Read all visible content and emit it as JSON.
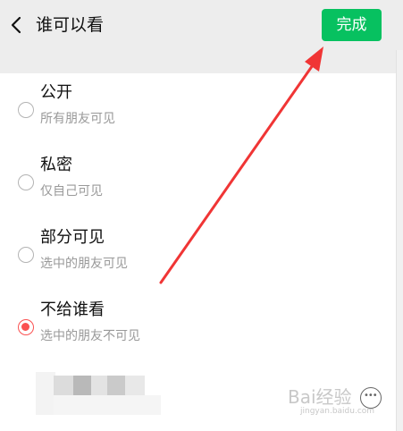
{
  "navbar": {
    "back_icon": "chevron-left-icon",
    "title": "谁可以看",
    "done_label": "完成"
  },
  "options": [
    {
      "title": "公开",
      "subtitle": "所有朋友可见",
      "selected": false
    },
    {
      "title": "私密",
      "subtitle": "仅自己可见",
      "selected": false
    },
    {
      "title": "部分可见",
      "subtitle": "选中的朋友可见",
      "selected": false
    },
    {
      "title": "不给谁看",
      "subtitle": "选中的朋友不可见",
      "selected": true
    }
  ],
  "watermark": {
    "text": "Bai经验",
    "sub": "jingyan.baidu.com"
  },
  "colors": {
    "accent_green": "#07c160",
    "selected_red": "#fa5151",
    "annotation_arrow": "#f03535"
  }
}
